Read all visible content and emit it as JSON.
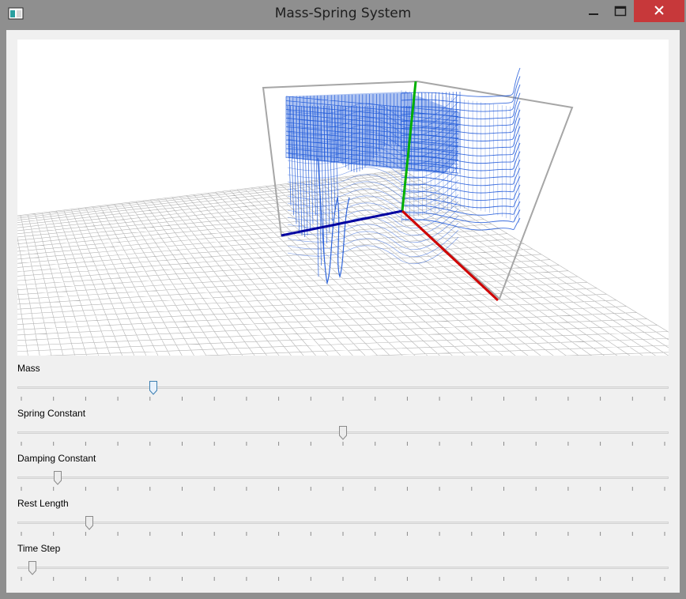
{
  "window": {
    "title": "Mass-Spring System"
  },
  "sliders": [
    {
      "label": "Mass",
      "value": 0.205,
      "active": true
    },
    {
      "label": "Spring Constant",
      "value": 0.5,
      "active": false
    },
    {
      "label": "Damping Constant",
      "value": 0.057,
      "active": false
    },
    {
      "label": "Rest Length",
      "value": 0.106,
      "active": false
    },
    {
      "label": "Time Step",
      "value": 0.017,
      "active": false
    }
  ],
  "tick_count": 21,
  "colors": {
    "cloth": "#1a55d8",
    "x_axis": "#d00000",
    "y_axis": "#00b000",
    "z_axis": "#0000a0",
    "floor_grid": "#b4b4b4",
    "close_button": "#c7383a"
  }
}
